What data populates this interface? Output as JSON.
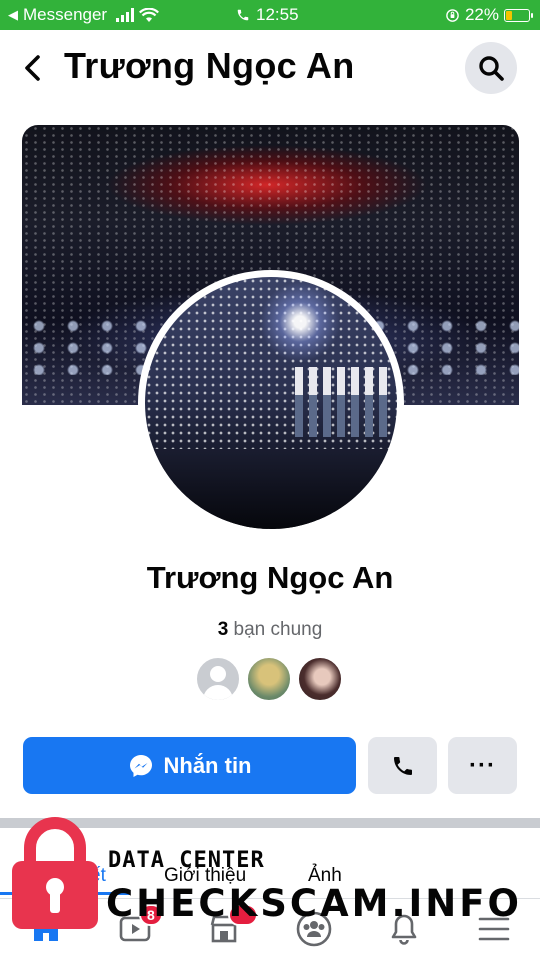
{
  "status_bar": {
    "back_app": "Messenger",
    "time": "12:55",
    "battery": "22%",
    "colors": {
      "background": "#32b23a",
      "battery_fill": "#f5c400"
    }
  },
  "header": {
    "title": "Trương Ngọc An",
    "icons": {
      "back": "chevron-left-icon",
      "search": "search-icon"
    }
  },
  "profile": {
    "name": "Trương Ngọc An",
    "mutual_count": "3",
    "mutual_label": "bạn chung"
  },
  "actions": {
    "message_label": "Nhắn tin",
    "more_label": "···",
    "icons": {
      "message": "messenger-icon",
      "call": "phone-icon",
      "more": "more-dots-icon"
    },
    "colors": {
      "primary": "#1877f2",
      "secondary": "#e4e6eb"
    }
  },
  "tabs": [
    {
      "label": "ết",
      "active": true
    },
    {
      "label": "Giới thiệu",
      "active": false
    },
    {
      "label": "Ảnh",
      "active": false
    }
  ],
  "bottom_nav": {
    "icons": [
      "home-icon",
      "watch-icon",
      "marketplace-icon",
      "groups-icon",
      "notifications-icon",
      "menu-icon"
    ],
    "badges": {
      "watch": "8",
      "marketplace": ""
    }
  },
  "watermark": {
    "line1": "DATA CENTER",
    "line2": "CHECKSCAM.INFO",
    "color": "#e8344e"
  }
}
